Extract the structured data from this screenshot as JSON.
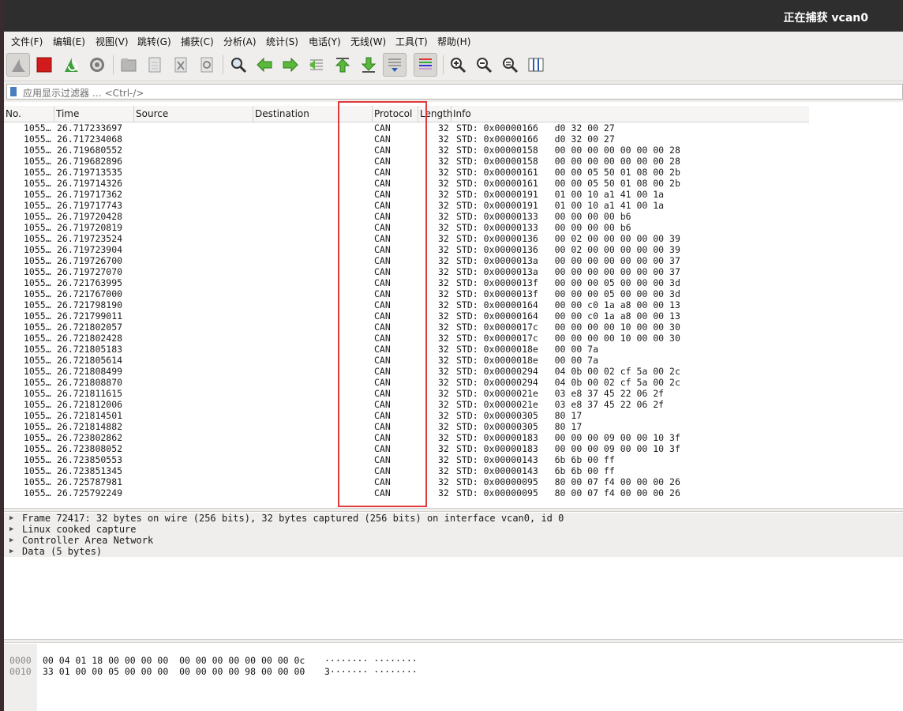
{
  "window": {
    "title": "正在捕获 vcan0"
  },
  "menu": [
    "文件(F)",
    "编辑(E)",
    "视图(V)",
    "跳转(G)",
    "捕获(C)",
    "分析(A)",
    "统计(S)",
    "电话(Y)",
    "无线(W)",
    "工具(T)",
    "帮助(H)"
  ],
  "toolbar": {
    "buttons": [
      "shark-fin-start",
      "stop-square",
      "restart-capture",
      "capture-options",
      "open-file",
      "save-file",
      "close-file",
      "reload-file",
      "find-packet",
      "go-back",
      "go-forward",
      "go-to-packet",
      "go-first",
      "go-last",
      "auto-scroll",
      "colorize",
      "zoom-in",
      "zoom-out",
      "zoom-normal",
      "resize-columns"
    ]
  },
  "filter": {
    "placeholder": "应用显示过滤器 … <Ctrl-/>"
  },
  "columns": [
    "No.",
    "Time",
    "Source",
    "Destination",
    "Protocol",
    "Length",
    "Info"
  ],
  "packets": [
    {
      "no": "1055…",
      "time": "26.717233697",
      "proto": "CAN",
      "len": "32",
      "info": "STD: 0x00000166   d0 32 00 27"
    },
    {
      "no": "1055…",
      "time": "26.717234068",
      "proto": "CAN",
      "len": "32",
      "info": "STD: 0x00000166   d0 32 00 27"
    },
    {
      "no": "1055…",
      "time": "26.719680552",
      "proto": "CAN",
      "len": "32",
      "info": "STD: 0x00000158   00 00 00 00 00 00 00 28"
    },
    {
      "no": "1055…",
      "time": "26.719682896",
      "proto": "CAN",
      "len": "32",
      "info": "STD: 0x00000158   00 00 00 00 00 00 00 28"
    },
    {
      "no": "1055…",
      "time": "26.719713535",
      "proto": "CAN",
      "len": "32",
      "info": "STD: 0x00000161   00 00 05 50 01 08 00 2b"
    },
    {
      "no": "1055…",
      "time": "26.719714326",
      "proto": "CAN",
      "len": "32",
      "info": "STD: 0x00000161   00 00 05 50 01 08 00 2b"
    },
    {
      "no": "1055…",
      "time": "26.719717362",
      "proto": "CAN",
      "len": "32",
      "info": "STD: 0x00000191   01 00 10 a1 41 00 1a"
    },
    {
      "no": "1055…",
      "time": "26.719717743",
      "proto": "CAN",
      "len": "32",
      "info": "STD: 0x00000191   01 00 10 a1 41 00 1a"
    },
    {
      "no": "1055…",
      "time": "26.719720428",
      "proto": "CAN",
      "len": "32",
      "info": "STD: 0x00000133   00 00 00 00 b6"
    },
    {
      "no": "1055…",
      "time": "26.719720819",
      "proto": "CAN",
      "len": "32",
      "info": "STD: 0x00000133   00 00 00 00 b6"
    },
    {
      "no": "1055…",
      "time": "26.719723524",
      "proto": "CAN",
      "len": "32",
      "info": "STD: 0x00000136   00 02 00 00 00 00 00 39"
    },
    {
      "no": "1055…",
      "time": "26.719723904",
      "proto": "CAN",
      "len": "32",
      "info": "STD: 0x00000136   00 02 00 00 00 00 00 39"
    },
    {
      "no": "1055…",
      "time": "26.719726700",
      "proto": "CAN",
      "len": "32",
      "info": "STD: 0x0000013a   00 00 00 00 00 00 00 37"
    },
    {
      "no": "1055…",
      "time": "26.719727070",
      "proto": "CAN",
      "len": "32",
      "info": "STD: 0x0000013a   00 00 00 00 00 00 00 37"
    },
    {
      "no": "1055…",
      "time": "26.721763995",
      "proto": "CAN",
      "len": "32",
      "info": "STD: 0x0000013f   00 00 00 05 00 00 00 3d"
    },
    {
      "no": "1055…",
      "time": "26.721767000",
      "proto": "CAN",
      "len": "32",
      "info": "STD: 0x0000013f   00 00 00 05 00 00 00 3d"
    },
    {
      "no": "1055…",
      "time": "26.721798190",
      "proto": "CAN",
      "len": "32",
      "info": "STD: 0x00000164   00 00 c0 1a a8 00 00 13"
    },
    {
      "no": "1055…",
      "time": "26.721799011",
      "proto": "CAN",
      "len": "32",
      "info": "STD: 0x00000164   00 00 c0 1a a8 00 00 13"
    },
    {
      "no": "1055…",
      "time": "26.721802057",
      "proto": "CAN",
      "len": "32",
      "info": "STD: 0x0000017c   00 00 00 00 10 00 00 30"
    },
    {
      "no": "1055…",
      "time": "26.721802428",
      "proto": "CAN",
      "len": "32",
      "info": "STD: 0x0000017c   00 00 00 00 10 00 00 30"
    },
    {
      "no": "1055…",
      "time": "26.721805183",
      "proto": "CAN",
      "len": "32",
      "info": "STD: 0x0000018e   00 00 7a"
    },
    {
      "no": "1055…",
      "time": "26.721805614",
      "proto": "CAN",
      "len": "32",
      "info": "STD: 0x0000018e   00 00 7a"
    },
    {
      "no": "1055…",
      "time": "26.721808499",
      "proto": "CAN",
      "len": "32",
      "info": "STD: 0x00000294   04 0b 00 02 cf 5a 00 2c"
    },
    {
      "no": "1055…",
      "time": "26.721808870",
      "proto": "CAN",
      "len": "32",
      "info": "STD: 0x00000294   04 0b 00 02 cf 5a 00 2c"
    },
    {
      "no": "1055…",
      "time": "26.721811615",
      "proto": "CAN",
      "len": "32",
      "info": "STD: 0x0000021e   03 e8 37 45 22 06 2f"
    },
    {
      "no": "1055…",
      "time": "26.721812006",
      "proto": "CAN",
      "len": "32",
      "info": "STD: 0x0000021e   03 e8 37 45 22 06 2f"
    },
    {
      "no": "1055…",
      "time": "26.721814501",
      "proto": "CAN",
      "len": "32",
      "info": "STD: 0x00000305   80 17"
    },
    {
      "no": "1055…",
      "time": "26.721814882",
      "proto": "CAN",
      "len": "32",
      "info": "STD: 0x00000305   80 17"
    },
    {
      "no": "1055…",
      "time": "26.723802862",
      "proto": "CAN",
      "len": "32",
      "info": "STD: 0x00000183   00 00 00 09 00 00 10 3f"
    },
    {
      "no": "1055…",
      "time": "26.723808052",
      "proto": "CAN",
      "len": "32",
      "info": "STD: 0x00000183   00 00 00 09 00 00 10 3f"
    },
    {
      "no": "1055…",
      "time": "26.723850553",
      "proto": "CAN",
      "len": "32",
      "info": "STD: 0x00000143   6b 6b 00 ff"
    },
    {
      "no": "1055…",
      "time": "26.723851345",
      "proto": "CAN",
      "len": "32",
      "info": "STD: 0x00000143   6b 6b 00 ff"
    },
    {
      "no": "1055…",
      "time": "26.725787981",
      "proto": "CAN",
      "len": "32",
      "info": "STD: 0x00000095   80 00 07 f4 00 00 00 26"
    },
    {
      "no": "1055…",
      "time": "26.725792249",
      "proto": "CAN",
      "len": "32",
      "info": "STD: 0x00000095   80 00 07 f4 00 00 00 26"
    }
  ],
  "details": [
    "Frame 72417: 32 bytes on wire (256 bits), 32 bytes captured (256 bits) on interface vcan0, id 0",
    "Linux cooked capture",
    "Controller Area Network",
    "Data (5 bytes)"
  ],
  "bytes": [
    {
      "offset": "0000",
      "hex": "00 04 01 18 00 00 00 00  00 00 00 00 00 00 00 0c",
      "ascii": "········ ········"
    },
    {
      "offset": "0010",
      "hex": "33 01 00 00 05 00 00 00  00 00 00 00 98 00 00 00",
      "ascii": "3······· ········"
    }
  ],
  "colors": {
    "highlight_box": "#e03a3a",
    "titlebar": "#2e2e2e"
  }
}
